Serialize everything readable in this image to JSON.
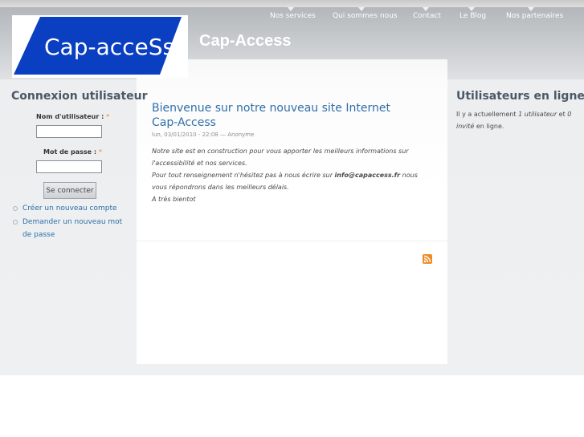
{
  "site": {
    "logo_text": "Cap-acceSs",
    "name": "Cap-Access"
  },
  "nav": {
    "items": [
      {
        "label": "Nos services"
      },
      {
        "label": "Qui sommes nous"
      },
      {
        "label": "Contact"
      },
      {
        "label": "Le Blog"
      },
      {
        "label": "Nos partenaires"
      }
    ]
  },
  "login": {
    "title": "Connexion utilisateur",
    "username_label": "Nom d'utilisateur :",
    "password_label": "Mot de passe :",
    "required_mark": "*",
    "username_value": "",
    "password_value": "",
    "submit_label": "Se connecter",
    "links": [
      {
        "label": "Créer un nouveau compte"
      },
      {
        "label": "Demander un nouveau mot de passe"
      }
    ]
  },
  "post": {
    "title": "Bienvenue sur notre nouveau site Internet Cap-Access",
    "meta": "lun, 03/01/2010 - 22:08 — Anonyme",
    "line1": "Notre site est en construction pour vous apporter les meilleurs informations sur l'accessibilité et nos services.",
    "line2_before": "Pour tout renseignement n'hésitez pas à nous écrire sur ",
    "line2_email": "info@capaccess.fr",
    "line2_after": " nous vous répondrons dans les meilleurs délais.",
    "line3": "A très bientot"
  },
  "online": {
    "title": "Utilisateurs en ligne",
    "text_before": "Il y a actuellement ",
    "users": "1 utilisateur",
    "text_mid": " et ",
    "guests": "0 invité",
    "text_after": " en ligne."
  },
  "icons": {
    "rss": "rss-feed-icon"
  },
  "colors": {
    "logo_blue": "#0a3fc2",
    "link_blue": "#2f6fa8",
    "rss_orange": "#f08a24"
  }
}
